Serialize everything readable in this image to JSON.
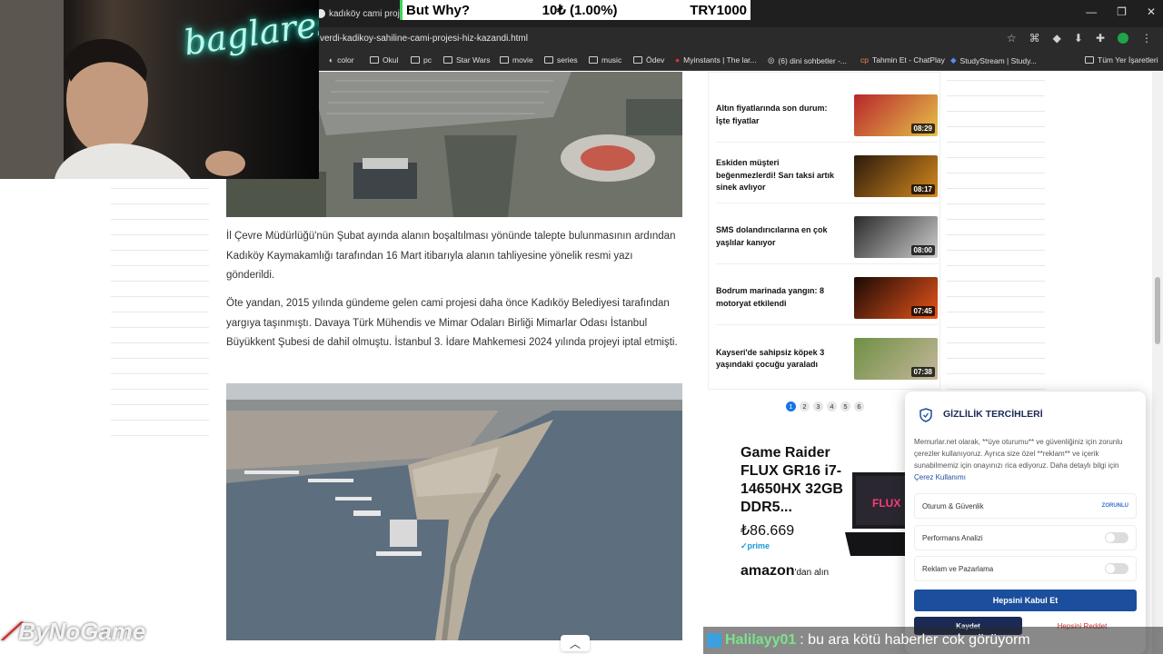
{
  "browser": {
    "tab_title": "kadıköy cami projesi",
    "url": "verdi-kadikoy-sahiline-cami-projesi-hiz-kazandi.html",
    "win_controls": [
      "—",
      "❐",
      "✕"
    ],
    "bookmarks": [
      "color",
      "Okul",
      "pc",
      "Star Wars",
      "movie",
      "series",
      "music",
      "Ödev",
      "Myinstants | The lar...",
      "(6) dini sohbetler -...",
      "Tahmin Et - ChatPlay",
      "StudyStream | Study...",
      "Tüm Yer İşaretleri"
    ]
  },
  "stream": {
    "question": "But Why?",
    "amount": "10₺ (1.00%)",
    "goal": "TRY1000",
    "neon_sign": "baglares",
    "logo": "ByNoGame",
    "chat_user": "Halilayy01",
    "chat_message": ": bu ara kötü haberler cok görüyorm"
  },
  "article": {
    "p1": "İl Çevre Müdürlüğü'nün Şubat ayında alanın boşaltılması yönünde talepte bulunmasının ardından Kadıköy Kaymakamlığı tarafından 16 Mart itibarıyla alanın tahliyesine yönelik resmi yazı gönderildi.",
    "p2": "Öte yandan, 2015 yılında gündeme gelen cami projesi daha önce Kadıköy Belediyesi tarafından yargıya taşınmıştı. Davaya Türk Mühendis ve Mimar Odaları Birliği Mimarlar Odası İstanbul Büyükkent Şubesi de dahil olmuştu. İstanbul 3. İdare Mahkemesi 2024 yılında projeyi iptal etmişti."
  },
  "news": [
    {
      "title": "Altın fiyatlarında son durum: İşte fiyatlar",
      "duration": "08:29",
      "color": "#b8262b"
    },
    {
      "title": "Eskiden müşteri beğenmezlerdi! Sarı taksi artık sinek avlıyor",
      "duration": "08:17",
      "color": "#6a3a10"
    },
    {
      "title": "SMS dolandırıcılarına en çok yaşlılar kanıyor",
      "duration": "08:00",
      "color": "#4a4a4a"
    },
    {
      "title": "Bodrum marinada yangın: 8 motoryat etkilendi",
      "duration": "07:45",
      "color": "#7a2a0e"
    },
    {
      "title": "Kayseri'de sahipsiz köpek 3 yaşındaki çocuğu yaraladı",
      "duration": "07:38",
      "color": "#5b7a3a"
    }
  ],
  "pager": [
    "1",
    "2",
    "3",
    "4",
    "5",
    "6"
  ],
  "ad": {
    "title": "Game Raider FLUX GR16 i7-14650HX 32GB DDR5...",
    "price": "₺86.669",
    "prime": "prime",
    "amazon": "amazon",
    "amazon_suffix": "'dan alın"
  },
  "cookie": {
    "title": "GİZLİLİK TERCİHLERİ",
    "text": "Memurlar.net olarak, **üye oturumu** ve güvenliğiniz için zorunlu çerezler kullanıyoruz. Ayrıca size özel **reklam** ve içerik sunabilmemiz için onayınızı rica ediyoruz. Daha detaylı bilgi için ",
    "link": "Çerez Kullanımı",
    "opt1": "Oturum & Güvenlik",
    "opt1_state": "ZORUNLU",
    "opt2": "Performans Analizi",
    "opt3": "Reklam ve Pazarlama",
    "accept": "Hepsini Kabul Et",
    "save": "Kaydet",
    "reject": "Hepsini Reddet"
  },
  "colors": {
    "accent": "#1b4e9c",
    "stream_green": "#3ed35a"
  }
}
